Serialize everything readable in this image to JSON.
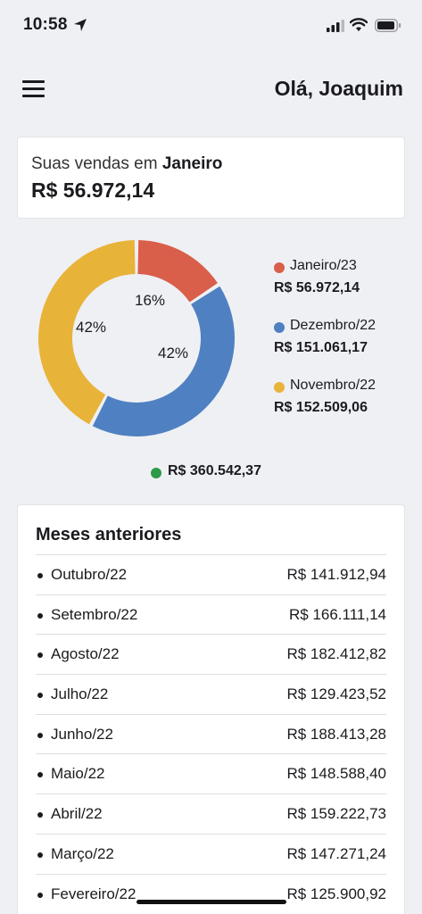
{
  "status_bar": {
    "time": "10:58",
    "icons": [
      "location-arrow-icon",
      "signal-icon",
      "wifi-icon",
      "battery-icon"
    ]
  },
  "header": {
    "menu_icon": "hamburger-menu-icon",
    "greeting": "Olá, Joaquim"
  },
  "sales_card": {
    "caption_prefix": "Suas vendas em ",
    "caption_month": "Janeiro",
    "total": "R$ 56.972,14"
  },
  "chart_data": {
    "type": "pie",
    "donut": true,
    "slices": [
      {
        "label": "Janeiro/23",
        "value": 56972.14,
        "value_text": "R$ 56.972,14",
        "percent": 16,
        "percent_text": "16%",
        "color": "#d95f4b"
      },
      {
        "label": "Dezembro/22",
        "value": 151061.17,
        "value_text": "R$ 151.061,17",
        "percent": 42,
        "percent_text": "42%",
        "color": "#4f81c2"
      },
      {
        "label": "Novembro/22",
        "value": 152509.06,
        "value_text": "R$ 152.509,06",
        "percent": 42,
        "percent_text": "42%",
        "color": "#e8b339"
      }
    ],
    "legend_position": "right",
    "total_text": "R$ 360.542,37",
    "total_color": "#2e9a47"
  },
  "previous_months": {
    "title": "Meses anteriores",
    "rows": [
      {
        "month": "Outubro/22",
        "value": "R$ 141.912,94"
      },
      {
        "month": "Setembro/22",
        "value": "R$ 166.111,14"
      },
      {
        "month": "Agosto/22",
        "value": "R$ 182.412,82"
      },
      {
        "month": "Julho/22",
        "value": "R$ 129.423,52"
      },
      {
        "month": "Junho/22",
        "value": "R$ 188.413,28"
      },
      {
        "month": "Maio/22",
        "value": "R$ 148.588,40"
      },
      {
        "month": "Abril/22",
        "value": "R$ 159.222,73"
      },
      {
        "month": "Março/22",
        "value": "R$ 147.271,24"
      },
      {
        "month": "Fevereiro/22",
        "value": "R$ 125.900,92"
      }
    ]
  }
}
